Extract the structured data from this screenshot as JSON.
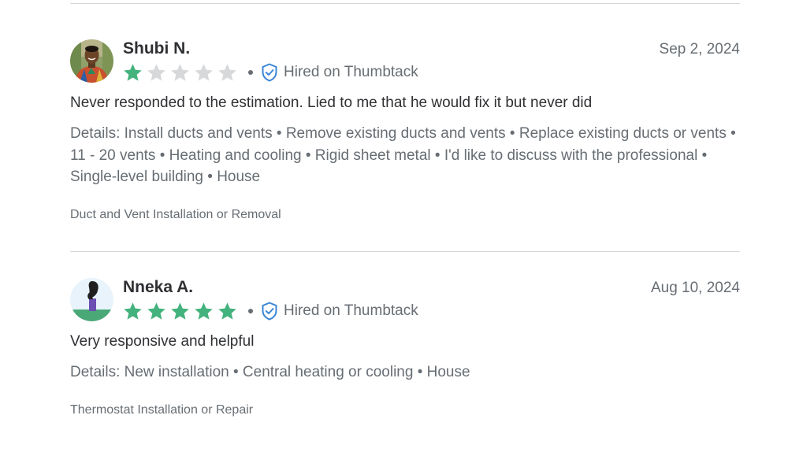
{
  "colors": {
    "star_filled": "#44b27c",
    "star_empty": "#d6d8da",
    "hired_badge": "#3a86d6",
    "text_primary": "#2f3033",
    "text_secondary": "#676d73",
    "divider": "#d6d6d6"
  },
  "reviews": [
    {
      "reviewer_name": "Shubi N.",
      "date": "Sep 2, 2024",
      "rating": 1,
      "rating_max": 5,
      "hired_label": "Hired on Thumbtack",
      "hired_icon": "shield-check-icon",
      "text": "Never responded to the estimation. Lied to me that he would fix it but never did",
      "details": "Details: Install ducts and vents • Remove existing ducts and vents • Replace existing ducts or vents • 11 - 20 vents • Heating and cooling • Rigid sheet metal • I'd like to discuss with the professional • Single-level building • House",
      "category": "Duct and Vent Installation or Removal",
      "avatar": "photo-avatar"
    },
    {
      "reviewer_name": "Nneka A.",
      "date": "Aug 10, 2024",
      "rating": 5,
      "rating_max": 5,
      "hired_label": "Hired on Thumbtack",
      "hired_icon": "shield-check-icon",
      "text": "Very responsive and helpful",
      "details": "Details: New installation • Central heating or cooling • House",
      "category": "Thermostat Installation or Repair",
      "avatar": "illustrated-avatar"
    }
  ]
}
